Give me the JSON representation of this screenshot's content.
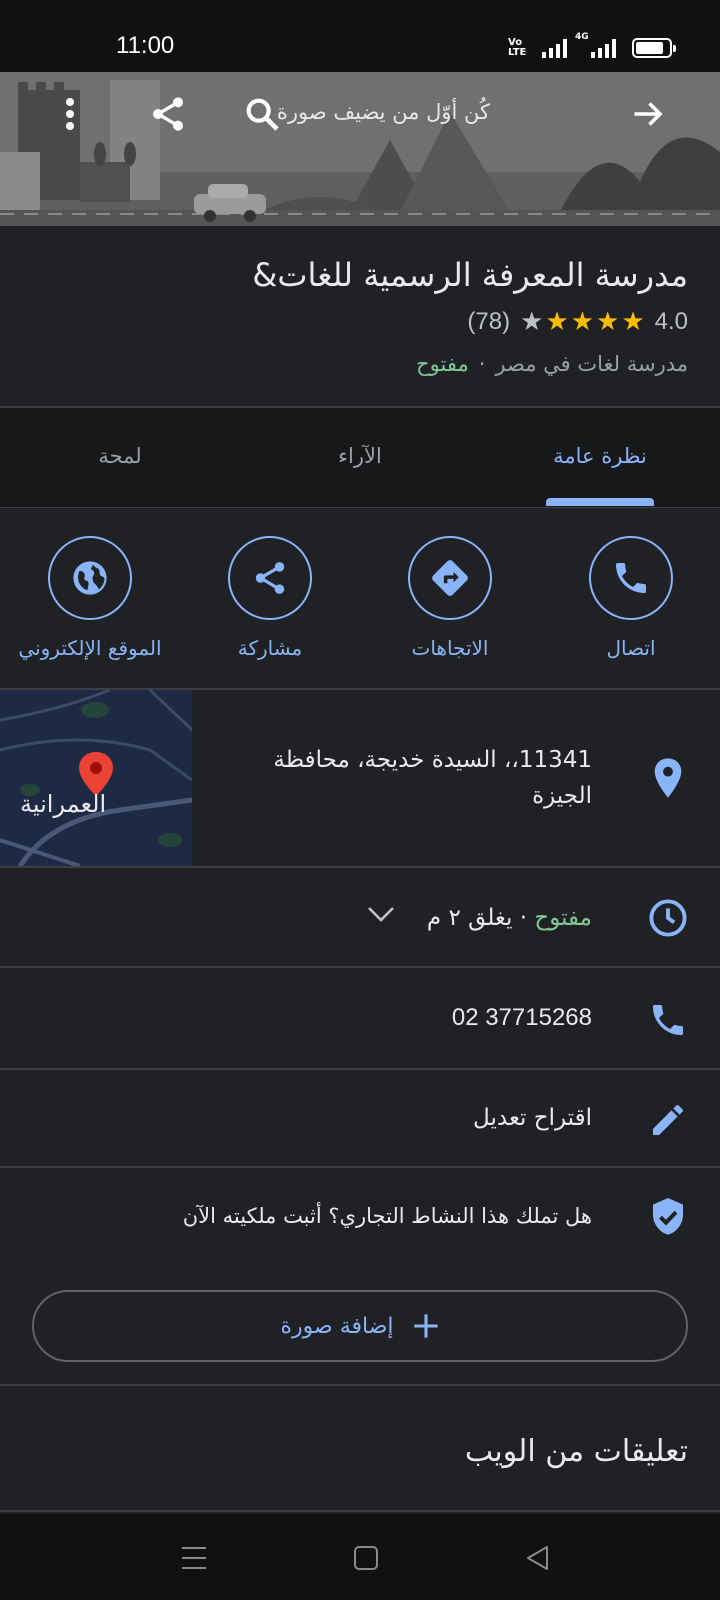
{
  "status_bar": {
    "time": "11:00",
    "volte_label": "Vo LTE",
    "network_label": "4G",
    "battery_level": 0.85
  },
  "hero": {
    "caption": "كُن أوّل من يضيف صورة",
    "icons": [
      "back-arrow-icon",
      "search-icon",
      "share-icon",
      "more-vert-icon"
    ]
  },
  "place": {
    "name": "مدرسة المعرفة الرسمية للغات&",
    "rating": "4.0",
    "stars": 4,
    "star_total": 5,
    "review_count": "(78)",
    "category": "مدرسة لغات في مصر",
    "separator": "·",
    "status": "مفتوح"
  },
  "tabs": [
    {
      "label": "نظرة عامة",
      "active": true
    },
    {
      "label": "الآراء",
      "active": false
    },
    {
      "label": "لمحة",
      "active": false
    }
  ],
  "actions": [
    {
      "label": "اتصال",
      "icon": "phone-icon"
    },
    {
      "label": "الاتجاهات",
      "icon": "directions-icon"
    },
    {
      "label": "مشاركة",
      "icon": "share-icon"
    },
    {
      "label": "الموقع الإلكتروني",
      "icon": "globe-icon"
    }
  ],
  "address": {
    "line1": "11341،، السيدة خديجة، محافظة",
    "line2": "الجيزة",
    "map_label": "العمرانية"
  },
  "hours": {
    "status": "مفتوح",
    "closes": " · يغلق ٢ م"
  },
  "phone": {
    "number": "02 37715268"
  },
  "suggest_edit": {
    "label": "اقتراح تعديل"
  },
  "claim": {
    "label": "هل تملك هذا النشاط التجاري؟ أثبت ملكيته الآن"
  },
  "add_photo": {
    "label": "إضافة صورة"
  },
  "web_reviews": {
    "title": "تعليقات من الويب"
  },
  "colors": {
    "accent": "#8ab4f8",
    "open": "#81c995",
    "star": "#fbbc04",
    "background": "#202124"
  }
}
